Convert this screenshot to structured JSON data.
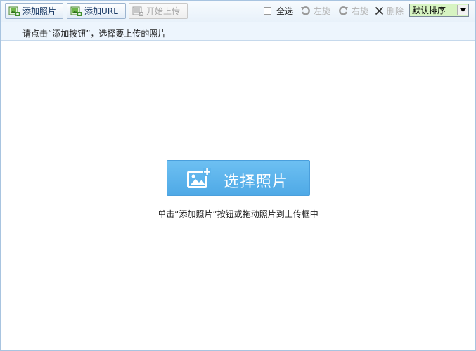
{
  "toolbar": {
    "add_photo_label": "添加照片",
    "add_url_label": "添加URL",
    "start_upload_label": "开始上传",
    "select_all_label": "全选",
    "rotate_left_label": "左旋",
    "rotate_right_label": "右旋",
    "delete_label": "删除",
    "sort": {
      "selected": "默认排序"
    }
  },
  "hint": {
    "text": "请点击“添加按钮”，选择要上传的照片"
  },
  "main": {
    "choose_button_label": "选择照片",
    "drop_hint": "单击“添加照片”按钮或拖动照片到上传框中"
  },
  "colors": {
    "accent": "#4fa9e6",
    "toolbar_bg": "#e8f1fa",
    "sort_bg": "#d7f4c2"
  }
}
